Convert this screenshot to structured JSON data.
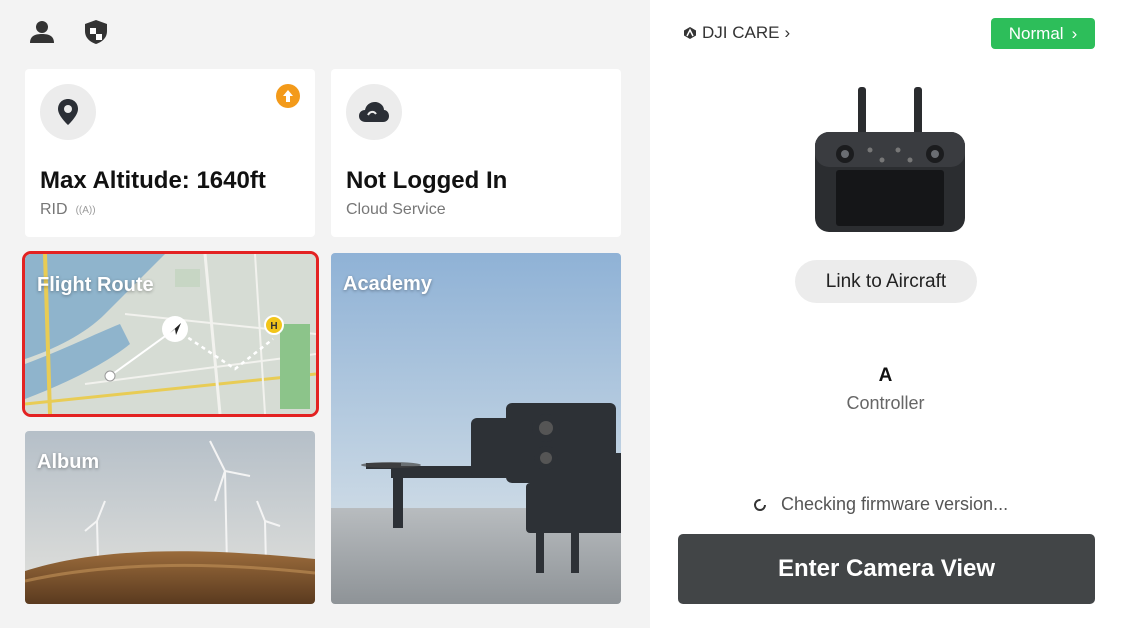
{
  "topbar": {
    "icons": [
      "user-icon",
      "shield-icon"
    ]
  },
  "altitude_card": {
    "icon": "location-pin-icon",
    "badge_icon": "update-arrow-icon",
    "badge_color": "#f39a1a",
    "title": "Max Altitude: 1640ft",
    "subtitle": "RID",
    "rid_signal": "((A))"
  },
  "cloud_card": {
    "icon": "cloud-icon",
    "title": "Not Logged In",
    "subtitle": "Cloud Service"
  },
  "tiles": {
    "flight_route": "Flight Route",
    "album": "Album",
    "academy": "Academy",
    "highlight_color": "#e32222"
  },
  "right_panel": {
    "care_label": "DJI CARE",
    "care_chevron": "›",
    "status_button": "Normal",
    "status_chevron": "›",
    "status_color": "#2dbe5a",
    "link_button": "Link to Aircraft",
    "device_name": "A",
    "device_type": "Controller",
    "firmware_status": "Checking firmware version...",
    "enter_button": "Enter Camera View"
  }
}
